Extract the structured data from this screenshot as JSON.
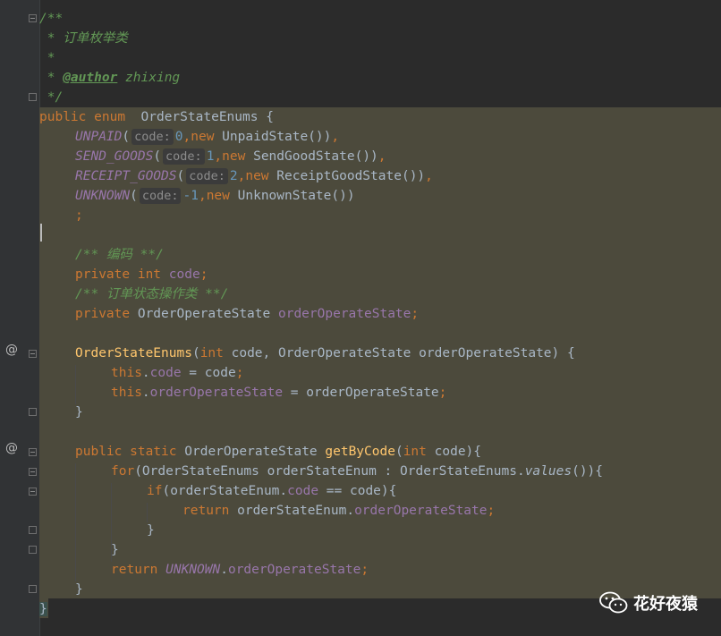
{
  "gutter": {
    "annotations": [
      "@",
      "@"
    ]
  },
  "code": {
    "doc_open": "/**",
    "doc_title": " * 订单枚举类",
    "doc_star": " *",
    "doc_author_prefix": " * ",
    "doc_author_tag": "@author",
    "doc_author_name": " zhixing",
    "doc_close": " */",
    "decl_kw1": "public",
    "decl_kw2": "enum",
    "decl_name": "OrderStateEnums",
    "decl_brace": "{",
    "consts": [
      {
        "name": "UNPAID",
        "hint": "code:",
        "value": "0",
        "cls": "UnpaidState"
      },
      {
        "name": "SEND_GOODS",
        "hint": "code:",
        "value": "1",
        "cls": "SendGoodState"
      },
      {
        "name": "RECEIPT_GOODS",
        "hint": "code:",
        "value": "2",
        "cls": "ReceiptGoodState"
      },
      {
        "name": "UNKNOWN",
        "hint": "code:",
        "value": "-1",
        "cls": "UnknownState"
      }
    ],
    "semicolon": ";",
    "comment_code": "/** 编码 **/",
    "field1_kw1": "private",
    "field1_kw2": "int",
    "field1_name": "code",
    "comment_state": "/** 订单状态操作类 **/",
    "field2_kw": "private",
    "field2_type": "OrderOperateState",
    "field2_name": "orderOperateState",
    "ctor_name": "OrderStateEnums",
    "ctor_kw_int": "int",
    "ctor_params_rest": " code, OrderOperateState orderOperateState) {",
    "this_kw": "this",
    "assign1_field": "code",
    "assign1_rest": " = code",
    "assign2_field": "orderOperateState",
    "assign2_rest": " = orderOperateState",
    "close_brace": "}",
    "m_kw_public": "public",
    "m_kw_static": "static",
    "m_type": "OrderOperateState",
    "m_name": "getByCode",
    "m_kw_int": "int",
    "m_param": " code){",
    "for_kw": "for",
    "for_head": "(OrderStateEnums orderStateEnum : OrderStateEnums.",
    "for_values": "values",
    "for_tail": "()){",
    "if_kw": "if",
    "if_head": "(orderStateEnum.",
    "if_field": "code",
    "if_tail": " == code){",
    "ret_kw": "return",
    "ret1_head": " orderStateEnum.",
    "ret1_field": "orderOperateState",
    "ret2_const": "UNKNOWN",
    "ret2_field": "orderOperateState"
  },
  "watermark": {
    "text": "花好夜猿"
  }
}
